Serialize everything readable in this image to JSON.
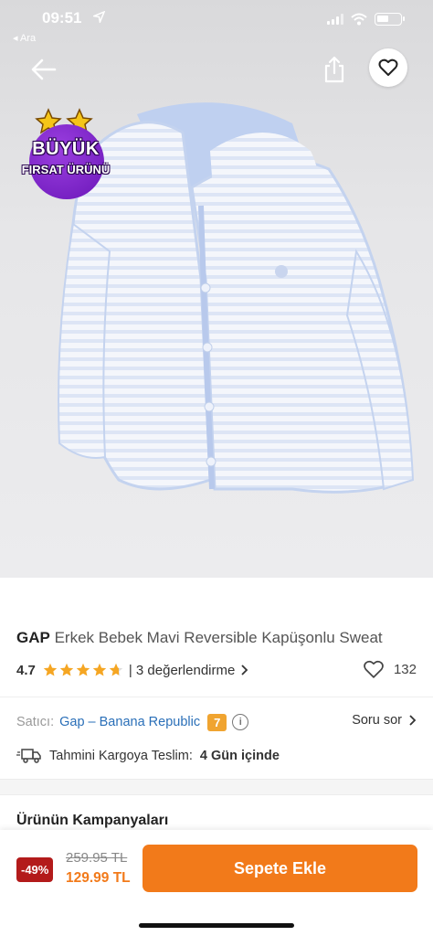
{
  "status_bar": {
    "time": "09:51",
    "back_app_label": "◂ Ara"
  },
  "deal_badge": {
    "line1": "BÜYÜK",
    "line2": "FIRSAT ÜRÜNÜ",
    "color": "#7b22c9"
  },
  "product": {
    "brand": "GAP",
    "name": "Erkek Bebek Mavi Reversible Kapüşonlu Sweat",
    "rating": "4.7",
    "stars_filled": 4.7,
    "reviews_label": "| 3 değerlendirme",
    "favorite_count": "132"
  },
  "seller": {
    "label": "Satıcı:",
    "name": "Gap – Banana Republic",
    "score": "7",
    "ask_label": "Soru sor"
  },
  "shipping": {
    "label": "Tahmini Kargoya Teslim:",
    "value": "4 Gün içinde"
  },
  "campaigns": {
    "title": "Ürünün Kampanyaları"
  },
  "bottom_bar": {
    "discount": "-49%",
    "old_price": "259.95 TL",
    "new_price": "129.99 TL",
    "add_to_cart": "Sepete Ekle"
  },
  "colors": {
    "accent": "#f27a1a",
    "link": "#2a6fb8",
    "discount": "#b31b1b",
    "star": "#f5a623",
    "seller_score": "#f0a430"
  },
  "icons": [
    "back-arrow-icon",
    "share-icon",
    "heart-icon",
    "location-arrow-icon",
    "signal-icon",
    "wifi-icon",
    "battery-icon",
    "star-icon",
    "info-icon",
    "chevron-right-icon",
    "truck-icon"
  ]
}
